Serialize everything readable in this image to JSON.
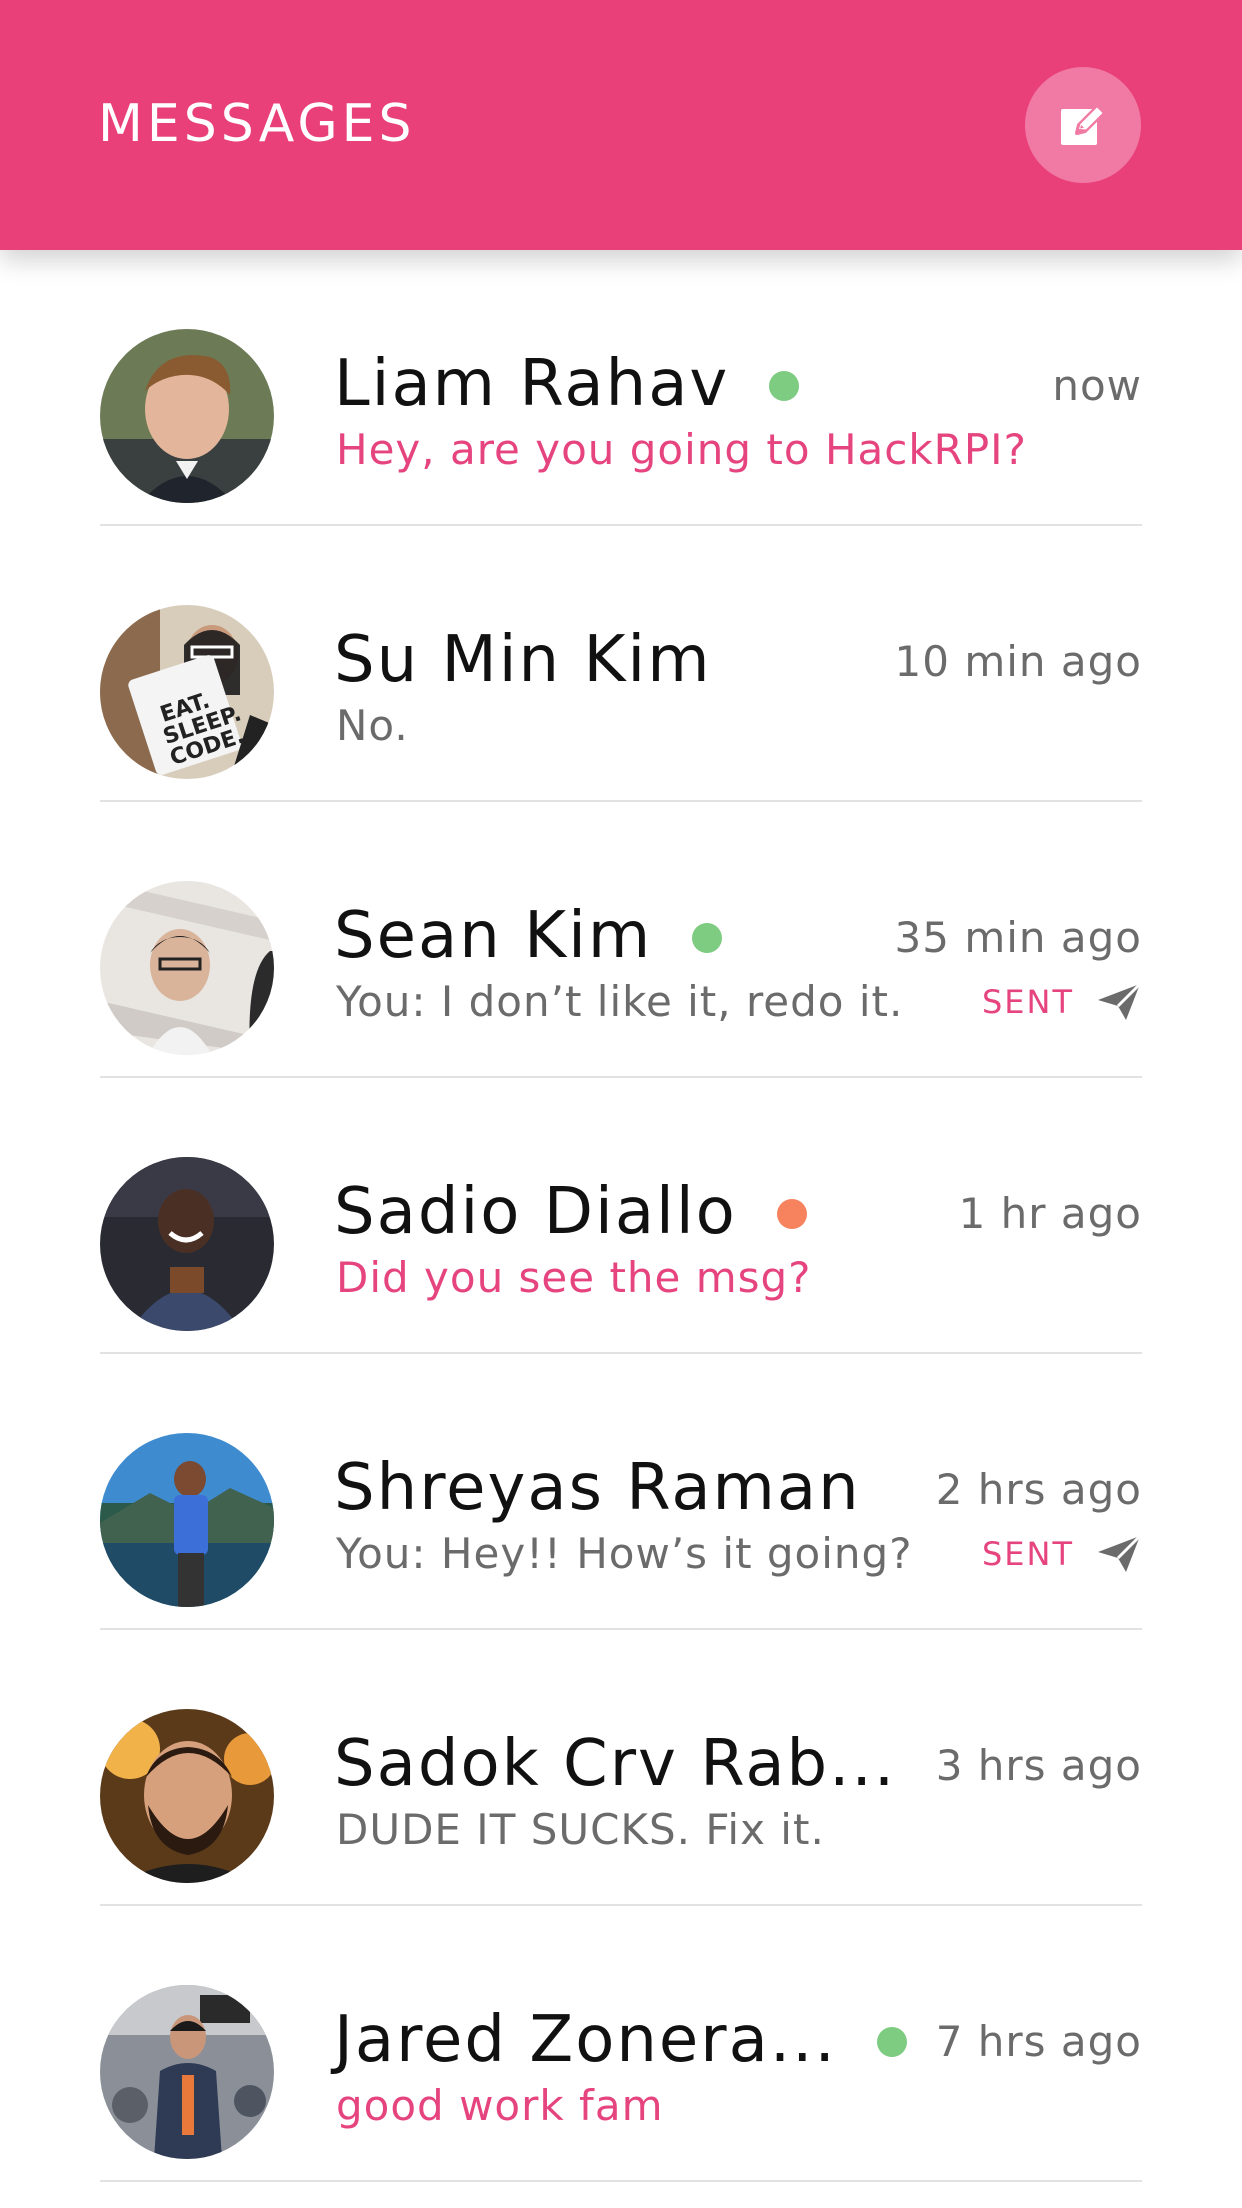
{
  "header": {
    "title": "MESSAGES",
    "compose_icon": "compose-icon",
    "background": "#EA4079"
  },
  "colors": {
    "online": "#7ECB82",
    "away": "#F6835E",
    "accent": "#E6447E",
    "muted": "#6b6b6b"
  },
  "conversations": [
    {
      "name": "Liam Rahav",
      "status": "online",
      "time": "now",
      "preview": "Hey, are you going to HackRPI?",
      "unread": true,
      "sent": false,
      "sent_label": ""
    },
    {
      "name": "Su Min Kim",
      "status": "none",
      "time": "10 min ago",
      "preview": "No.",
      "unread": false,
      "sent": false,
      "sent_label": ""
    },
    {
      "name": "Sean Kim",
      "status": "online",
      "time": "35 min ago",
      "preview": "You: I don’t like it, redo it.",
      "unread": false,
      "sent": true,
      "sent_label": "SENT"
    },
    {
      "name": "Sadio Diallo",
      "status": "away",
      "time": "1 hr ago",
      "preview": "Did you see the msg?",
      "unread": true,
      "sent": false,
      "sent_label": ""
    },
    {
      "name": "Shreyas Raman",
      "status": "none",
      "time": "2 hrs ago",
      "preview": "You: Hey!! How’s it going?",
      "unread": false,
      "sent": true,
      "sent_label": "SENT"
    },
    {
      "name": "Sadok Crv Rab...",
      "status": "none",
      "time": "3 hrs ago",
      "preview": "DUDE IT SUCKS. Fix it.",
      "unread": false,
      "sent": false,
      "sent_label": ""
    },
    {
      "name": "Jared Zonera...",
      "status": "online",
      "time": "7 hrs ago",
      "preview": "good work fam",
      "unread": true,
      "sent": false,
      "sent_label": ""
    }
  ]
}
